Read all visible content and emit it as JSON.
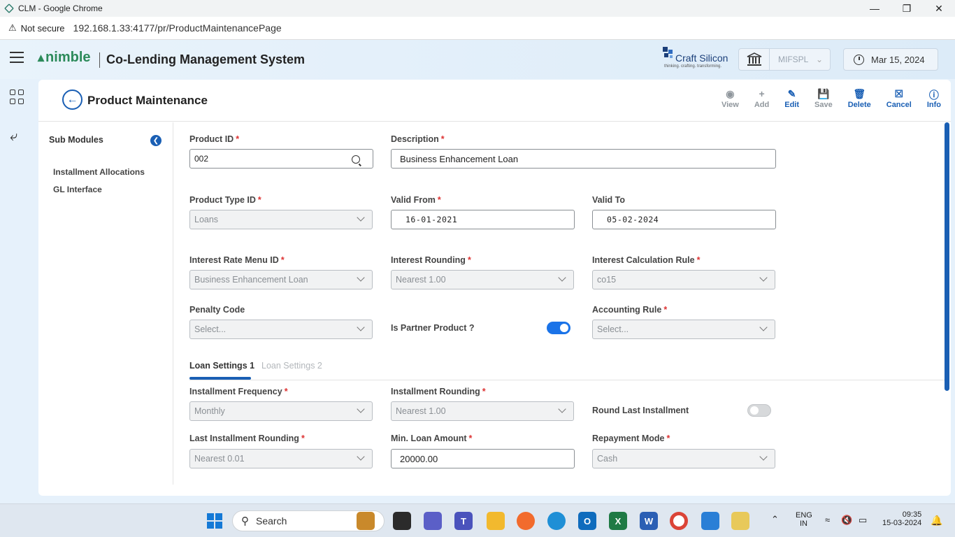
{
  "browser": {
    "window_title": "CLM - Google Chrome",
    "security_label": "Not secure",
    "url": "192.168.1.33:4177/pr/ProductMaintenancePage"
  },
  "header": {
    "logo_text": "nimble",
    "app_title": "Co-Lending Management System",
    "partner_name": "Craft Silicon",
    "partner_tagline": "thinking. crafting. transforming.",
    "org_select_value": "MIFSPL",
    "date": "Mar 15, 2024"
  },
  "page": {
    "title": "Product Maintenance",
    "toolbar": {
      "view": "View",
      "add": "Add",
      "edit": "Edit",
      "save": "Save",
      "delete": "Delete",
      "cancel": "Cancel",
      "info": "Info"
    }
  },
  "sub_modules": {
    "title": "Sub Modules",
    "items": [
      "Installment Allocations",
      "GL Interface"
    ]
  },
  "form": {
    "product_id": {
      "label": "Product ID",
      "value": "002"
    },
    "description": {
      "label": "Description",
      "value": "Business Enhancement Loan"
    },
    "product_type_id": {
      "label": "Product Type ID",
      "value": "Loans"
    },
    "valid_from": {
      "label": "Valid From",
      "value": "16-01-2021"
    },
    "valid_to": {
      "label": "Valid To",
      "value": "05-02-2024"
    },
    "interest_rate_menu_id": {
      "label": "Interest Rate Menu ID",
      "value": "Business Enhancement Loan"
    },
    "interest_rounding": {
      "label": "Interest Rounding",
      "value": "Nearest 1.00"
    },
    "interest_calculation_rule": {
      "label": "Interest Calculation Rule",
      "value": "co15"
    },
    "penalty_code": {
      "label": "Penalty Code",
      "placeholder": "Select..."
    },
    "is_partner_product": {
      "label": "Is Partner Product ?",
      "checked": true
    },
    "accounting_rule": {
      "label": "Accounting Rule",
      "placeholder": "Select..."
    }
  },
  "tabs": [
    "Loan Settings 1",
    "Loan Settings 2"
  ],
  "loan_settings": {
    "installment_frequency": {
      "label": "Installment Frequency",
      "value": "Monthly"
    },
    "installment_rounding": {
      "label": "Installment Rounding",
      "value": "Nearest 1.00"
    },
    "round_last_installment": {
      "label": "Round Last Installment",
      "checked": false
    },
    "last_installment_rounding": {
      "label": "Last Installment Rounding",
      "value": "Nearest 0.01"
    },
    "min_loan_amount": {
      "label": "Min. Loan Amount",
      "value": "20000.00"
    },
    "repayment_mode": {
      "label": "Repayment Mode",
      "value": "Cash"
    }
  },
  "taskbar": {
    "search_label": "Search",
    "language": "ENG",
    "region": "IN",
    "time": "09:35",
    "date": "15-03-2024"
  }
}
